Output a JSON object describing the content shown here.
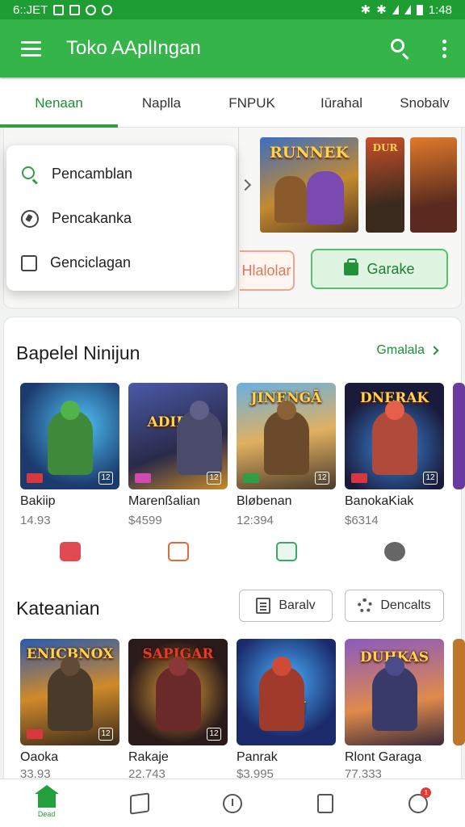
{
  "status_bar": {
    "left_text": "6::JET",
    "time": "1:48"
  },
  "app_bar": {
    "title": "Toko AAplIngan"
  },
  "tabs": [
    {
      "label": "Nenaan",
      "active": true
    },
    {
      "label": "Naplla",
      "active": false
    },
    {
      "label": "FNPUK",
      "active": false
    },
    {
      "label": "Iūrahal",
      "active": false
    },
    {
      "label": "Snobalv",
      "active": false
    }
  ],
  "dropdown": {
    "items": [
      {
        "label": "Pencamblan",
        "icon": "search-icon"
      },
      {
        "label": "Pencakanka",
        "icon": "compass-icon"
      },
      {
        "label": "Genciclagan",
        "icon": "checkbox-icon"
      }
    ]
  },
  "banner": {
    "art_title": "RUNNEK",
    "art_small": "DUR",
    "button_secondary": "Hlalolar",
    "button_primary": "Garake"
  },
  "section_popular": {
    "title": "Bapelel Ninijun",
    "see_all": "Gmalala",
    "apps": [
      {
        "name": "Bakiip",
        "price": "14.93",
        "art_text": "",
        "icon_color": "#e24a52"
      },
      {
        "name": "Marenßalian",
        "price": "$4599",
        "art_text": "ADIEKA",
        "icon_color": "#e06a3a"
      },
      {
        "name": "Bløbenan",
        "price": "12:394",
        "art_text": "JINENGĀ",
        "icon_color": "#3aa86b"
      },
      {
        "name": "BanokaKiak",
        "price": "$6314",
        "art_text": "DNERAK",
        "icon_color": "#666666"
      }
    ]
  },
  "section_categories": {
    "title": "Kateanian",
    "filter_1": "Baralv",
    "filter_2": "Dencalts",
    "apps": [
      {
        "name": "Oaoka",
        "price": "33.93",
        "art_text": "ENICBNOX"
      },
      {
        "name": "Rakaje",
        "price": "22.743",
        "art_text": "SAPIGAR"
      },
      {
        "name": "Panrak",
        "price": "$3.995",
        "art_text": "TON"
      },
      {
        "name": "Rlont Garaga",
        "price": "77.333",
        "art_text": "DUHKAS"
      }
    ]
  },
  "bottom_nav": {
    "home_label": "Dead",
    "badge": "1"
  }
}
